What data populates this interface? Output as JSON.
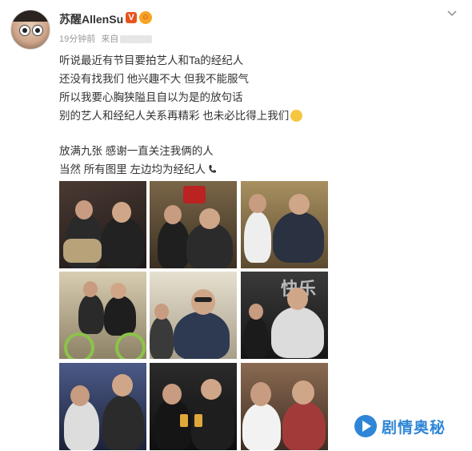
{
  "post": {
    "author": "苏醒AllenSu",
    "verified_badge": "V",
    "time": "19分钟前",
    "source_prefix": "来自",
    "lines": [
      "听说最近有节目要拍艺人和Ta的经纪人",
      "还没有找我们 他兴趣不大 但我不能服气",
      "所以我要心胸狭隘且自以为是的放句话",
      "别的艺人和经纪人关系再精彩 也未必比得上我们",
      "",
      "放满九张 感谢一直关注我俩的人",
      "当然 所有图里 左边均为经纪人"
    ]
  },
  "photos": [
    {
      "label": "photo-1",
      "bg": "#3a2e2a"
    },
    {
      "label": "photo-2",
      "bg": "#6b5a3e"
    },
    {
      "label": "photo-3",
      "bg": "#8a7550"
    },
    {
      "label": "photo-4",
      "bg": "#b8a888"
    },
    {
      "label": "photo-5",
      "bg": "#c9c1ae"
    },
    {
      "label": "photo-6",
      "bg": "#2a2a2a"
    },
    {
      "label": "photo-7",
      "bg": "#3d4a6e"
    },
    {
      "label": "photo-8",
      "bg": "#1f1f1f"
    },
    {
      "label": "photo-9",
      "bg": "#7a5d4a"
    }
  ],
  "watermark": {
    "text": "剧情奥秘"
  },
  "colors": {
    "accent": "#2f86d6",
    "verified": "#e8541e"
  }
}
